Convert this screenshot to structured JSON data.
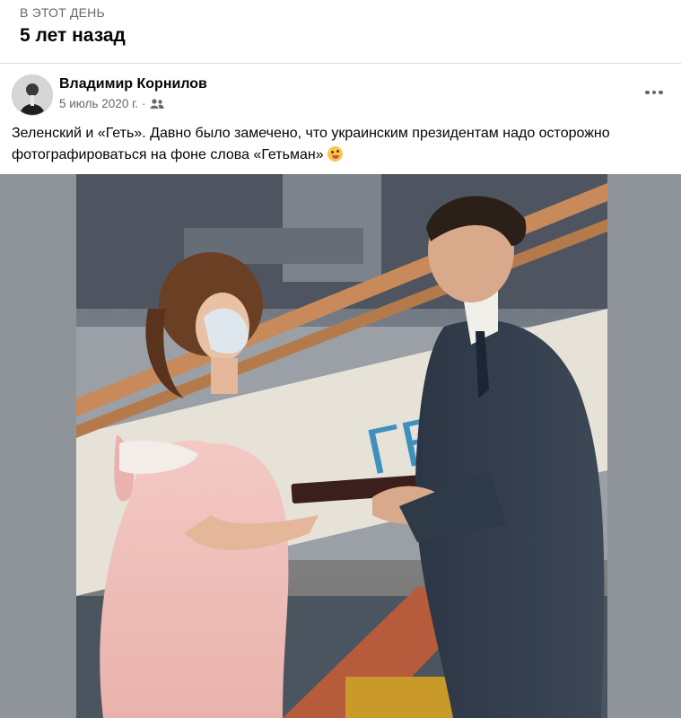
{
  "memories": {
    "kicker": "В ЭТОТ ДЕНЬ",
    "title": "5 лет назад"
  },
  "post": {
    "author": "Владимир Корнилов",
    "date": "5 июль 2020 г.",
    "separator": "·",
    "audience_icon": "friends-icon",
    "more_icon": "more-options-icon",
    "text": "Зеленский и «Геть». Давно было замечено, что украинским президентам надо осторожно фотографироваться на фоне слова «Гетьман»",
    "emoji": "winking-tongue-face-emoji",
    "photo": {
      "description_icon": "ceremony-photo",
      "sign_text": "ГЕТЬ"
    }
  },
  "colors": {
    "photo_backdrop": "#8f949b",
    "secondary_text": "#65676b",
    "divider": "#dadde1"
  }
}
